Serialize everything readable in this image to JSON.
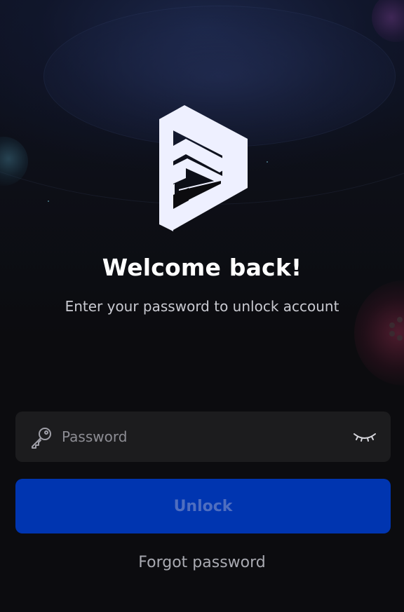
{
  "welcome": {
    "title": "Welcome back!",
    "subtitle": "Enter your password to unlock account"
  },
  "password_field": {
    "placeholder": "Password",
    "value": "",
    "leading_icon": "key-icon",
    "trailing_icon": "eye-closed-icon"
  },
  "actions": {
    "unlock_label": "Unlock",
    "forgot_label": "Forgot password"
  },
  "colors": {
    "background": "#0c0c0f",
    "field_background": "#1c1c1e",
    "primary_button": "#0035b0",
    "primary_button_text": "#4f6ec0",
    "title_text": "#ffffff",
    "subtitle_text": "#c9cad1",
    "link_text": "#a9aab1"
  }
}
